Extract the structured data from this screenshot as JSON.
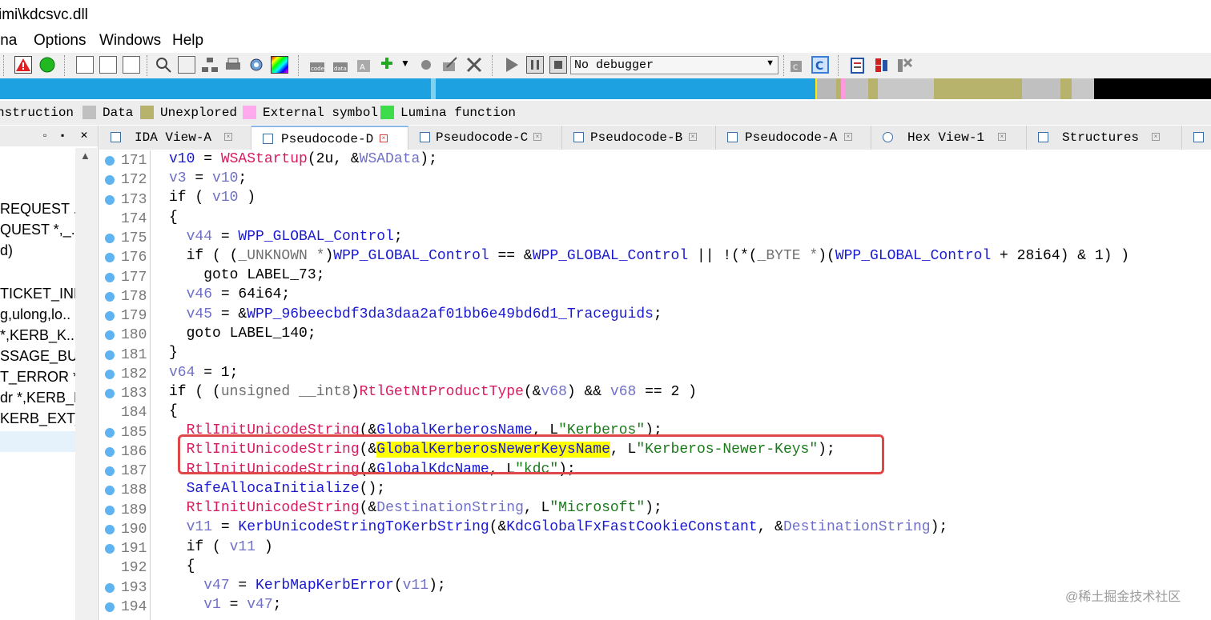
{
  "window": {
    "title": "imi\\kdcsvc.dll"
  },
  "menu": {
    "items": [
      "ina",
      "Options",
      "Windows",
      "Help"
    ]
  },
  "toolbar": {
    "debugger_select": "No debugger"
  },
  "legend": {
    "items": [
      {
        "label": "nstruction",
        "color": ""
      },
      {
        "label": "Data",
        "color": "#c0c0c0"
      },
      {
        "label": "Unexplored",
        "color": "#b7b36c"
      },
      {
        "label": "External symbol",
        "color": "#ffaaee"
      },
      {
        "label": "Lumina function",
        "color": "#3ddc4a"
      }
    ]
  },
  "left_panel": {
    "items": [
      "REQUEST ..",
      "QUEST *,_..",
      "d)",
      "TICKET_INF..",
      "g,ulong,lo..",
      " *,KERB_K..",
      "SSAGE_BU..",
      "T_ERROR *",
      "dr *,KERB_K",
      "KERB_EXT_.."
    ]
  },
  "tabs": [
    {
      "label": "IDA View-A"
    },
    {
      "label": "Pseudocode-D"
    },
    {
      "label": "Pseudocode-C"
    },
    {
      "label": "Pseudocode-B"
    },
    {
      "label": "Pseudocode-A"
    },
    {
      "label": "Hex View-1"
    },
    {
      "label": "Structures"
    }
  ],
  "code": {
    "lines": [
      {
        "num": "171",
        "dot": true
      },
      {
        "num": "172",
        "dot": true
      },
      {
        "num": "173",
        "dot": true
      },
      {
        "num": "174",
        "dot": false
      },
      {
        "num": "175",
        "dot": true
      },
      {
        "num": "176",
        "dot": true
      },
      {
        "num": "177",
        "dot": true
      },
      {
        "num": "178",
        "dot": true
      },
      {
        "num": "179",
        "dot": true
      },
      {
        "num": "180",
        "dot": true
      },
      {
        "num": "181",
        "dot": true
      },
      {
        "num": "182",
        "dot": true
      },
      {
        "num": "183",
        "dot": true
      },
      {
        "num": "184",
        "dot": false
      },
      {
        "num": "185",
        "dot": true
      },
      {
        "num": "186",
        "dot": true
      },
      {
        "num": "187",
        "dot": true
      },
      {
        "num": "188",
        "dot": true
      },
      {
        "num": "189",
        "dot": true
      },
      {
        "num": "190",
        "dot": true
      },
      {
        "num": "191",
        "dot": true
      },
      {
        "num": "192",
        "dot": false
      },
      {
        "num": "193",
        "dot": true
      },
      {
        "num": "194",
        "dot": true
      }
    ],
    "l171": {
      "a": "v10",
      "b": " = ",
      "c": "WSAStartup",
      "d": "(2u, &",
      "e": "WSAData",
      "f": ");"
    },
    "l172": {
      "a": "v3",
      "b": " = ",
      "c": "v10",
      "d": ";"
    },
    "l173": {
      "a": "if ( ",
      "b": "v10",
      "c": " )"
    },
    "l174": {
      "a": "{"
    },
    "l175": {
      "a": "  ",
      "b": "v44",
      "c": " = ",
      "d": "WPP_GLOBAL_Control",
      "e": ";"
    },
    "l176": {
      "a": "  if ( (",
      "b": "_UNKNOWN *",
      "c": ")",
      "d": "WPP_GLOBAL_Control",
      "e": " == &",
      "f": "WPP_GLOBAL_Control",
      "g": " || !(*(",
      "h": "_BYTE *",
      "i": ")(",
      "j": "WPP_GLOBAL_Control",
      "k": " + 28i64) & 1) )"
    },
    "l177": {
      "a": "    goto LABEL_73;"
    },
    "l178": {
      "a": "  ",
      "b": "v46",
      "c": " = 64i64;"
    },
    "l179": {
      "a": "  ",
      "b": "v45",
      "c": " = &",
      "d": "WPP_96beecbdf3da3daa2af01bb6e49bd6d1_Traceguids",
      "e": ";"
    },
    "l180": {
      "a": "  goto LABEL_140;"
    },
    "l181": {
      "a": "}"
    },
    "l182": {
      "a": "v64",
      "b": " = 1;"
    },
    "l183": {
      "a": "if ( (",
      "b": "unsigned __int8",
      "c": ")",
      "d": "RtlGetNtProductType",
      "e": "(&",
      "f": "v68",
      "g": ") && ",
      "h": "v68",
      "i": " == 2 )"
    },
    "l184": {
      "a": "{"
    },
    "l185": {
      "a": "  ",
      "b": "RtlInitUnicodeString",
      "c": "(&",
      "d": "GlobalKerberosName",
      "e": ", L",
      "f": "\"Kerberos\"",
      "g": ");"
    },
    "l186": {
      "a": "  ",
      "b": "RtlInitUnicodeString",
      "c": "(&",
      "d": "GlobalKerberosNewerKeysName",
      "e": ", L",
      "f": "\"Kerberos-Newer-Keys\"",
      "g": ");"
    },
    "l187": {
      "a": "  ",
      "b": "RtlInitUnicodeString",
      "c": "(&",
      "d": "GlobalKdcName",
      "e": ", L",
      "f": "\"kdc\"",
      "g": ");"
    },
    "l188": {
      "a": "  ",
      "b": "SafeAllocaInitialize",
      "c": "();"
    },
    "l189": {
      "a": "  ",
      "b": "RtlInitUnicodeString",
      "c": "(&",
      "d": "DestinationString",
      "e": ", L",
      "f": "\"Microsoft\"",
      "g": ");"
    },
    "l190": {
      "a": "  ",
      "b": "v11",
      "c": " = ",
      "d": "KerbUnicodeStringToKerbString",
      "e": "(&",
      "f": "KdcGlobalFxFastCookieConstant",
      "g": ", &",
      "h": "DestinationString",
      "i": ");"
    },
    "l191": {
      "a": "  if ( ",
      "b": "v11",
      "c": " )"
    },
    "l192": {
      "a": "  {"
    },
    "l193": {
      "a": "    ",
      "b": "v47",
      "c": " = ",
      "d": "KerbMapKerbError",
      "e": "(",
      "f": "v11",
      "g": ");"
    },
    "l194": {
      "a": "    ",
      "b": "v1",
      "c": " = ",
      "d": "v47",
      "e": ";"
    }
  },
  "watermark": "@稀土掘金技术社区",
  "colors": {
    "accent": "#1a1ad0",
    "function": "#d81b60",
    "string": "#1a7a1a",
    "highlight": "#ffff00",
    "annotation_box": "#e04848",
    "line_marker": "#5fb3f0"
  }
}
